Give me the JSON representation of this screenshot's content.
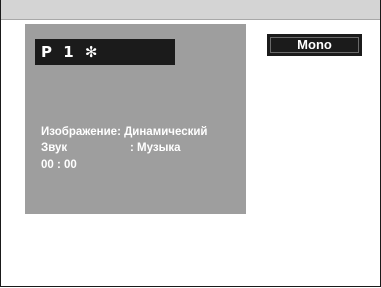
{
  "osd": {
    "channel": "P 1 ✻",
    "picture_label": "Изображение",
    "picture_value": "Динамический",
    "sound_label": "Звук",
    "sound_value": "Музыка",
    "time": "00 : 00"
  },
  "audio_mode": "Mono"
}
